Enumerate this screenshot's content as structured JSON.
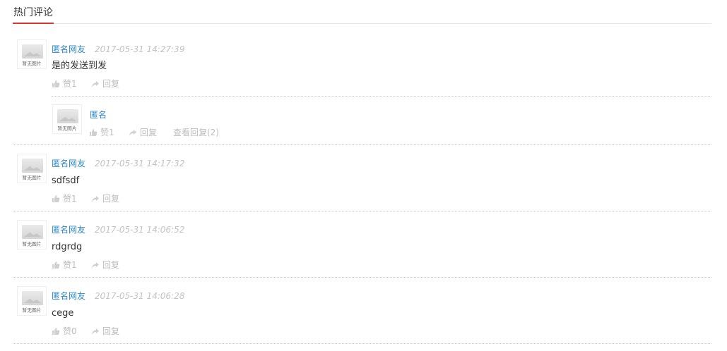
{
  "header": {
    "title": "热门评论"
  },
  "avatar_caption": "暂无图片",
  "icons": {
    "like": "thumbs-up-icon",
    "reply": "reply-arrow-icon"
  },
  "colors": {
    "name": "#2b89c8",
    "accent_underline": "#d9362f",
    "muted": "#bdbdbd"
  },
  "comments": [
    {
      "user": "匿名网友",
      "time": "2017-05-31 14:27:39",
      "text": "是的发送到发",
      "like_label": "赞1",
      "reply_label": "回复",
      "reply": {
        "user": "匿名",
        "like_label": "赞1",
        "reply_label": "回复",
        "view_replies_label": "查看回复(2)"
      }
    },
    {
      "user": "匿名网友",
      "time": "2017-05-31 14:17:32",
      "text": "sdfsdf",
      "like_label": "赞1",
      "reply_label": "回复"
    },
    {
      "user": "匿名网友",
      "time": "2017-05-31 14:06:52",
      "text": "rdgrdg",
      "like_label": "赞1",
      "reply_label": "回复"
    },
    {
      "user": "匿名网友",
      "time": "2017-05-31 14:06:28",
      "text": "cege",
      "like_label": "赞0",
      "reply_label": "回复"
    }
  ]
}
